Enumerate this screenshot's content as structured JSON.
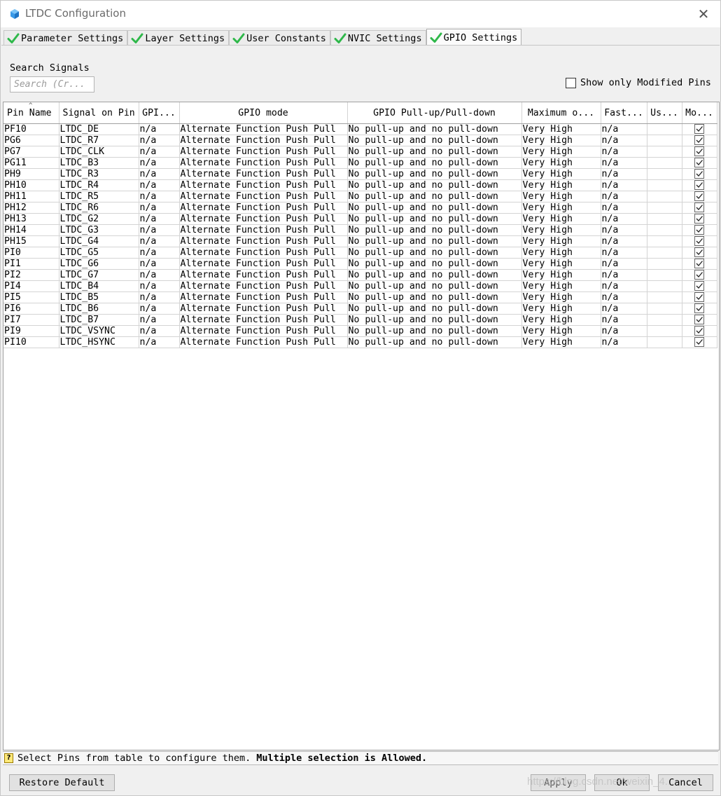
{
  "window": {
    "title": "LTDC Configuration",
    "close_glyph": "✕"
  },
  "tabs": [
    {
      "label": "Parameter Settings",
      "active": false
    },
    {
      "label": "Layer Settings",
      "active": false
    },
    {
      "label": "User Constants",
      "active": false
    },
    {
      "label": "NVIC Settings",
      "active": false
    },
    {
      "label": "GPIO Settings",
      "active": true
    }
  ],
  "search": {
    "label": "Search Signals",
    "placeholder": "Search (Cr..."
  },
  "show_modified": {
    "label": "Show only Modified Pins",
    "checked": false
  },
  "table": {
    "columns": [
      "Pin Name",
      "Signal on Pin",
      "GPI...",
      "GPIO mode",
      "GPIO Pull-up/Pull-down",
      "Maximum o...",
      "Fast...",
      "Us...",
      "Mo..."
    ],
    "sorted_column": "Pin Name",
    "rows": [
      {
        "pin": "PF10",
        "signal": "LTDC_DE",
        "gpio": "n/a",
        "mode": "Alternate Function Push Pull",
        "pull": "No pull-up and no pull-down",
        "max": "Very High",
        "fast": "n/a",
        "user": "",
        "modified": true
      },
      {
        "pin": "PG6",
        "signal": "LTDC_R7",
        "gpio": "n/a",
        "mode": "Alternate Function Push Pull",
        "pull": "No pull-up and no pull-down",
        "max": "Very High",
        "fast": "n/a",
        "user": "",
        "modified": true
      },
      {
        "pin": "PG7",
        "signal": "LTDC_CLK",
        "gpio": "n/a",
        "mode": "Alternate Function Push Pull",
        "pull": "No pull-up and no pull-down",
        "max": "Very High",
        "fast": "n/a",
        "user": "",
        "modified": true
      },
      {
        "pin": "PG11",
        "signal": "LTDC_B3",
        "gpio": "n/a",
        "mode": "Alternate Function Push Pull",
        "pull": "No pull-up and no pull-down",
        "max": "Very High",
        "fast": "n/a",
        "user": "",
        "modified": true
      },
      {
        "pin": "PH9",
        "signal": "LTDC_R3",
        "gpio": "n/a",
        "mode": "Alternate Function Push Pull",
        "pull": "No pull-up and no pull-down",
        "max": "Very High",
        "fast": "n/a",
        "user": "",
        "modified": true
      },
      {
        "pin": "PH10",
        "signal": "LTDC_R4",
        "gpio": "n/a",
        "mode": "Alternate Function Push Pull",
        "pull": "No pull-up and no pull-down",
        "max": "Very High",
        "fast": "n/a",
        "user": "",
        "modified": true
      },
      {
        "pin": "PH11",
        "signal": "LTDC_R5",
        "gpio": "n/a",
        "mode": "Alternate Function Push Pull",
        "pull": "No pull-up and no pull-down",
        "max": "Very High",
        "fast": "n/a",
        "user": "",
        "modified": true
      },
      {
        "pin": "PH12",
        "signal": "LTDC_R6",
        "gpio": "n/a",
        "mode": "Alternate Function Push Pull",
        "pull": "No pull-up and no pull-down",
        "max": "Very High",
        "fast": "n/a",
        "user": "",
        "modified": true
      },
      {
        "pin": "PH13",
        "signal": "LTDC_G2",
        "gpio": "n/a",
        "mode": "Alternate Function Push Pull",
        "pull": "No pull-up and no pull-down",
        "max": "Very High",
        "fast": "n/a",
        "user": "",
        "modified": true
      },
      {
        "pin": "PH14",
        "signal": "LTDC_G3",
        "gpio": "n/a",
        "mode": "Alternate Function Push Pull",
        "pull": "No pull-up and no pull-down",
        "max": "Very High",
        "fast": "n/a",
        "user": "",
        "modified": true
      },
      {
        "pin": "PH15",
        "signal": "LTDC_G4",
        "gpio": "n/a",
        "mode": "Alternate Function Push Pull",
        "pull": "No pull-up and no pull-down",
        "max": "Very High",
        "fast": "n/a",
        "user": "",
        "modified": true
      },
      {
        "pin": "PI0",
        "signal": "LTDC_G5",
        "gpio": "n/a",
        "mode": "Alternate Function Push Pull",
        "pull": "No pull-up and no pull-down",
        "max": "Very High",
        "fast": "n/a",
        "user": "",
        "modified": true
      },
      {
        "pin": "PI1",
        "signal": "LTDC_G6",
        "gpio": "n/a",
        "mode": "Alternate Function Push Pull",
        "pull": "No pull-up and no pull-down",
        "max": "Very High",
        "fast": "n/a",
        "user": "",
        "modified": true
      },
      {
        "pin": "PI2",
        "signal": "LTDC_G7",
        "gpio": "n/a",
        "mode": "Alternate Function Push Pull",
        "pull": "No pull-up and no pull-down",
        "max": "Very High",
        "fast": "n/a",
        "user": "",
        "modified": true
      },
      {
        "pin": "PI4",
        "signal": "LTDC_B4",
        "gpio": "n/a",
        "mode": "Alternate Function Push Pull",
        "pull": "No pull-up and no pull-down",
        "max": "Very High",
        "fast": "n/a",
        "user": "",
        "modified": true
      },
      {
        "pin": "PI5",
        "signal": "LTDC_B5",
        "gpio": "n/a",
        "mode": "Alternate Function Push Pull",
        "pull": "No pull-up and no pull-down",
        "max": "Very High",
        "fast": "n/a",
        "user": "",
        "modified": true
      },
      {
        "pin": "PI6",
        "signal": "LTDC_B6",
        "gpio": "n/a",
        "mode": "Alternate Function Push Pull",
        "pull": "No pull-up and no pull-down",
        "max": "Very High",
        "fast": "n/a",
        "user": "",
        "modified": true
      },
      {
        "pin": "PI7",
        "signal": "LTDC_B7",
        "gpio": "n/a",
        "mode": "Alternate Function Push Pull",
        "pull": "No pull-up and no pull-down",
        "max": "Very High",
        "fast": "n/a",
        "user": "",
        "modified": true
      },
      {
        "pin": "PI9",
        "signal": "LTDC_VSYNC",
        "gpio": "n/a",
        "mode": "Alternate Function Push Pull",
        "pull": "No pull-up and no pull-down",
        "max": "Very High",
        "fast": "n/a",
        "user": "",
        "modified": true
      },
      {
        "pin": "PI10",
        "signal": "LTDC_HSYNC",
        "gpio": "n/a",
        "mode": "Alternate Function Push Pull",
        "pull": "No pull-up and no pull-down",
        "max": "Very High",
        "fast": "n/a",
        "user": "",
        "modified": true
      }
    ]
  },
  "status": {
    "icon": "help-icon",
    "text": "Select Pins from table to configure them.",
    "bold_text": "Multiple selection is Allowed."
  },
  "buttons": {
    "restore": "Restore Default",
    "apply": "Apply",
    "ok": "Ok",
    "cancel": "Cancel"
  },
  "watermark": "https://blog.csdn.net/weixin_4..."
}
